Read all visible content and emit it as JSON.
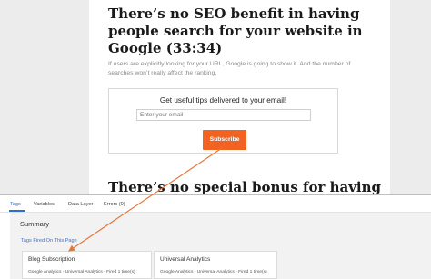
{
  "article": {
    "heading1": "There’s no SEO benefit in having people search for your website in Google (33:34)",
    "paragraph": "If users are explicitly looking for your URL, Google is going to show it. And the number of searches won’t really affect the ranking.",
    "optin": {
      "title": "Get useful tips delivered to your email!",
      "email_placeholder": "Enter your email",
      "subscribe_label": "Subscribe"
    },
    "heading2": "There’s no special bonus for having"
  },
  "debug_panel": {
    "tabs": [
      {
        "label": "Tags",
        "active": true
      },
      {
        "label": "Variables",
        "active": false
      },
      {
        "label": "Data Layer",
        "active": false
      },
      {
        "label": "Errors (0)",
        "active": false
      }
    ],
    "summary_title": "Summary",
    "fired_label": "Tags Fired On This Page",
    "tags_fired": [
      {
        "name": "Blog Subscription",
        "meta": "Google Analytics - Universal Analytics - Fired 1 time(s)"
      },
      {
        "name": "Universal Analytics",
        "meta": "Google Analytics - Universal Analytics - Fired 1 time(s)"
      }
    ]
  },
  "colors": {
    "accent_orange": "#f26322",
    "link_blue": "#3a72c8",
    "tab_active": "#2a6fcf"
  }
}
